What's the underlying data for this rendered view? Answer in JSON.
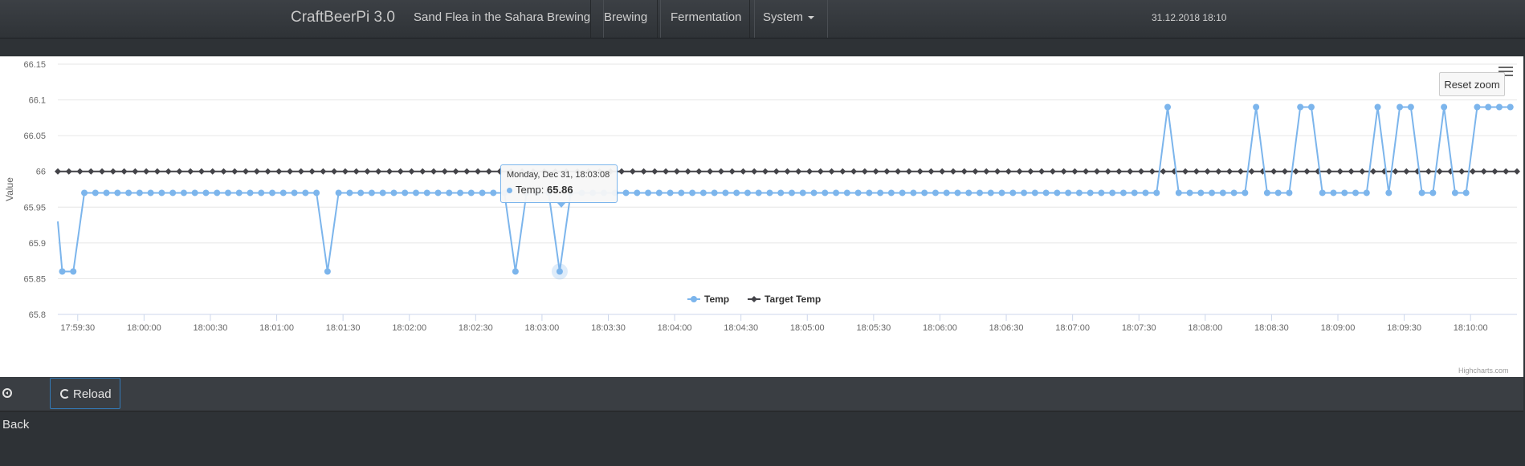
{
  "navbar": {
    "brand": "CraftBeerPi 3.0",
    "items": [
      {
        "label": "Sand Flea in the Sahara Brewing"
      },
      {
        "label": "Brewing"
      },
      {
        "label": "Fermentation"
      },
      {
        "label": "System"
      }
    ],
    "datetime": "31.12.2018 18:10"
  },
  "chart": {
    "reset_zoom_label": "Reset zoom",
    "credit": "Highcharts.com",
    "tooltip": {
      "date": "Monday, Dec 31, 18:03:08",
      "series": "Temp",
      "value": "65.86"
    }
  },
  "chart_data": {
    "type": "line",
    "ylabel": "Value",
    "ylim": [
      65.8,
      66.15
    ],
    "yticks": [
      "65.8",
      "65.85",
      "65.9",
      "65.95",
      "66",
      "66.05",
      "66.1",
      "66.15"
    ],
    "xticks": [
      "17:59:30",
      "18:00:00",
      "18:00:30",
      "18:01:00",
      "18:01:30",
      "18:02:00",
      "18:02:30",
      "18:03:00",
      "18:03:30",
      "18:04:00",
      "18:04:30",
      "18:05:00",
      "18:05:30",
      "18:06:00",
      "18:06:30",
      "18:07:00",
      "18:07:30",
      "18:08:00",
      "18:08:30",
      "18:09:00",
      "18:09:30",
      "18:10:00"
    ],
    "x_range": [
      "17:59:21",
      "18:10:21"
    ],
    "grid": true,
    "legend": "bottom-center",
    "series": [
      {
        "name": "Temp",
        "color": "#7cb5ec",
        "points": [
          [
            "17:59:21",
            65.93
          ],
          [
            "17:59:23",
            65.86
          ],
          [
            "17:59:28",
            65.86
          ],
          [
            "17:59:33",
            65.97
          ],
          [
            "17:59:38",
            65.97
          ],
          [
            "17:59:43",
            65.97
          ],
          [
            "17:59:48",
            65.97
          ],
          [
            "17:59:53",
            65.97
          ],
          [
            "17:59:58",
            65.97
          ],
          [
            "18:00:03",
            65.97
          ],
          [
            "18:00:08",
            65.97
          ],
          [
            "18:00:13",
            65.97
          ],
          [
            "18:00:18",
            65.97
          ],
          [
            "18:00:23",
            65.97
          ],
          [
            "18:00:28",
            65.97
          ],
          [
            "18:00:33",
            65.97
          ],
          [
            "18:00:38",
            65.97
          ],
          [
            "18:00:43",
            65.97
          ],
          [
            "18:00:48",
            65.97
          ],
          [
            "18:00:53",
            65.97
          ],
          [
            "18:00:58",
            65.97
          ],
          [
            "18:01:03",
            65.97
          ],
          [
            "18:01:08",
            65.97
          ],
          [
            "18:01:13",
            65.97
          ],
          [
            "18:01:18",
            65.97
          ],
          [
            "18:01:23",
            65.86
          ],
          [
            "18:01:28",
            65.97
          ],
          [
            "18:01:33",
            65.97
          ],
          [
            "18:01:38",
            65.97
          ],
          [
            "18:01:43",
            65.97
          ],
          [
            "18:01:48",
            65.97
          ],
          [
            "18:01:53",
            65.97
          ],
          [
            "18:01:58",
            65.97
          ],
          [
            "18:02:03",
            65.97
          ],
          [
            "18:02:08",
            65.97
          ],
          [
            "18:02:13",
            65.97
          ],
          [
            "18:02:18",
            65.97
          ],
          [
            "18:02:23",
            65.97
          ],
          [
            "18:02:28",
            65.97
          ],
          [
            "18:02:33",
            65.97
          ],
          [
            "18:02:38",
            65.97
          ],
          [
            "18:02:43",
            65.97
          ],
          [
            "18:02:48",
            65.86
          ],
          [
            "18:02:53",
            65.97
          ],
          [
            "18:02:58",
            65.97
          ],
          [
            "18:03:03",
            65.97
          ],
          [
            "18:03:08",
            65.86
          ],
          [
            "18:03:13",
            65.97
          ],
          [
            "18:03:18",
            65.97
          ],
          [
            "18:03:23",
            65.97
          ],
          [
            "18:03:28",
            65.97
          ],
          [
            "18:03:33",
            65.97
          ],
          [
            "18:03:38",
            65.97
          ],
          [
            "18:03:43",
            65.97
          ],
          [
            "18:03:48",
            65.97
          ],
          [
            "18:03:53",
            65.97
          ],
          [
            "18:03:58",
            65.97
          ],
          [
            "18:04:03",
            65.97
          ],
          [
            "18:04:08",
            65.97
          ],
          [
            "18:04:13",
            65.97
          ],
          [
            "18:04:18",
            65.97
          ],
          [
            "18:04:23",
            65.97
          ],
          [
            "18:04:28",
            65.97
          ],
          [
            "18:04:33",
            65.97
          ],
          [
            "18:04:38",
            65.97
          ],
          [
            "18:04:43",
            65.97
          ],
          [
            "18:04:48",
            65.97
          ],
          [
            "18:04:53",
            65.97
          ],
          [
            "18:04:58",
            65.97
          ],
          [
            "18:05:03",
            65.97
          ],
          [
            "18:05:08",
            65.97
          ],
          [
            "18:05:13",
            65.97
          ],
          [
            "18:05:18",
            65.97
          ],
          [
            "18:05:23",
            65.97
          ],
          [
            "18:05:28",
            65.97
          ],
          [
            "18:05:33",
            65.97
          ],
          [
            "18:05:38",
            65.97
          ],
          [
            "18:05:43",
            65.97
          ],
          [
            "18:05:48",
            65.97
          ],
          [
            "18:05:53",
            65.97
          ],
          [
            "18:05:58",
            65.97
          ],
          [
            "18:06:03",
            65.97
          ],
          [
            "18:06:08",
            65.97
          ],
          [
            "18:06:13",
            65.97
          ],
          [
            "18:06:18",
            65.97
          ],
          [
            "18:06:23",
            65.97
          ],
          [
            "18:06:28",
            65.97
          ],
          [
            "18:06:33",
            65.97
          ],
          [
            "18:06:38",
            65.97
          ],
          [
            "18:06:43",
            65.97
          ],
          [
            "18:06:48",
            65.97
          ],
          [
            "18:06:53",
            65.97
          ],
          [
            "18:06:58",
            65.97
          ],
          [
            "18:07:03",
            65.97
          ],
          [
            "18:07:08",
            65.97
          ],
          [
            "18:07:13",
            65.97
          ],
          [
            "18:07:18",
            65.97
          ],
          [
            "18:07:23",
            65.97
          ],
          [
            "18:07:28",
            65.97
          ],
          [
            "18:07:33",
            65.97
          ],
          [
            "18:07:38",
            65.97
          ],
          [
            "18:07:43",
            66.09
          ],
          [
            "18:07:48",
            65.97
          ],
          [
            "18:07:53",
            65.97
          ],
          [
            "18:07:58",
            65.97
          ],
          [
            "18:08:03",
            65.97
          ],
          [
            "18:08:08",
            65.97
          ],
          [
            "18:08:13",
            65.97
          ],
          [
            "18:08:18",
            65.97
          ],
          [
            "18:08:23",
            66.09
          ],
          [
            "18:08:28",
            65.97
          ],
          [
            "18:08:33",
            65.97
          ],
          [
            "18:08:38",
            65.97
          ],
          [
            "18:08:43",
            66.09
          ],
          [
            "18:08:48",
            66.09
          ],
          [
            "18:08:53",
            65.97
          ],
          [
            "18:08:58",
            65.97
          ],
          [
            "18:09:03",
            65.97
          ],
          [
            "18:09:08",
            65.97
          ],
          [
            "18:09:13",
            65.97
          ],
          [
            "18:09:18",
            66.09
          ],
          [
            "18:09:23",
            65.97
          ],
          [
            "18:09:28",
            66.09
          ],
          [
            "18:09:33",
            66.09
          ],
          [
            "18:09:38",
            65.97
          ],
          [
            "18:09:43",
            65.97
          ],
          [
            "18:09:48",
            66.09
          ],
          [
            "18:09:53",
            65.97
          ],
          [
            "18:09:58",
            65.97
          ],
          [
            "18:10:03",
            66.09
          ],
          [
            "18:10:08",
            66.09
          ],
          [
            "18:10:13",
            66.09
          ],
          [
            "18:10:18",
            66.09
          ]
        ]
      },
      {
        "name": "Target Temp",
        "color": "#434348",
        "constant_value": 66.0,
        "point_interval_seconds": 5
      }
    ]
  },
  "footer": {
    "back_label": "Back",
    "reload_label": "Reload"
  }
}
